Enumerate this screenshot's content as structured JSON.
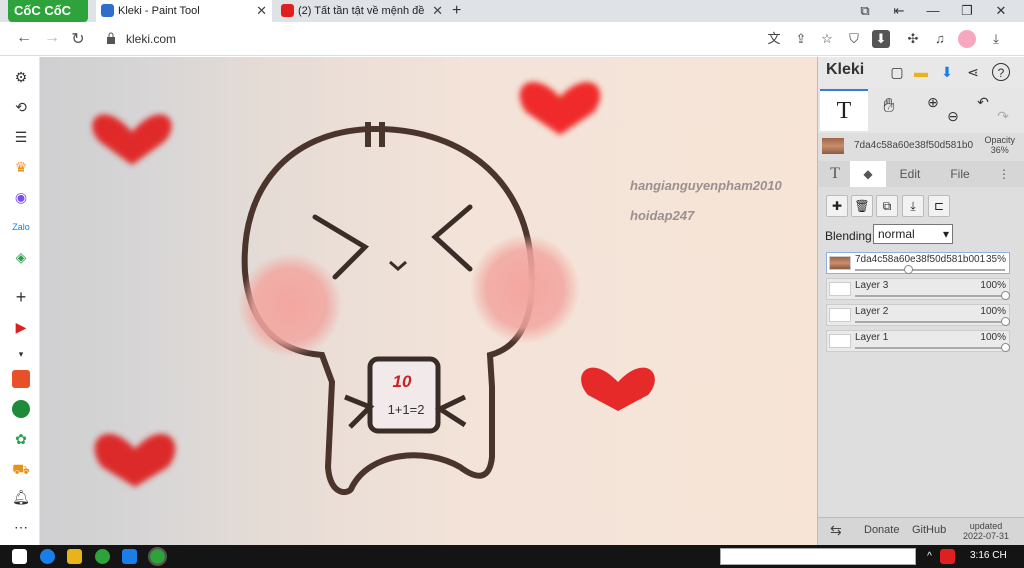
{
  "browser": {
    "brand": "CốC CốC",
    "tabs": [
      {
        "title": "Kleki - Paint Tool",
        "active": true
      },
      {
        "title": "(2) Tất tần tật về mệnh đề",
        "active": false
      }
    ],
    "url": "kleki.com"
  },
  "canvas": {
    "watermarks": [
      "hangianguyenpham2010",
      "hoidap247"
    ],
    "drawing_text": {
      "score": "10",
      "equation": "1+1=2"
    }
  },
  "kleki": {
    "logo": "Kleki",
    "active_tool": "T",
    "brush": {
      "name": "7da4c58a60e38f50d581b0",
      "opacity_label": "Opacity",
      "opacity_value": "36%"
    },
    "tabs": [
      "T",
      "Edit",
      "File"
    ],
    "blending_label": "Blending",
    "blending_value": "normal",
    "layers": [
      {
        "name": "7da4c58a60e38f50d581b001",
        "opacity": "35%",
        "fraction": 0.35,
        "selected": true
      },
      {
        "name": "Layer 3",
        "opacity": "100%",
        "fraction": 1.0,
        "selected": false
      },
      {
        "name": "Layer 2",
        "opacity": "100%",
        "fraction": 1.0,
        "selected": false
      },
      {
        "name": "Layer 1",
        "opacity": "100%",
        "fraction": 1.0,
        "selected": false
      }
    ],
    "footer": {
      "donate": "Donate",
      "github": "GitHub",
      "updated_label": "updated",
      "updated_date": "2022-07-31"
    }
  },
  "taskbar": {
    "time": "3:16 CH"
  }
}
